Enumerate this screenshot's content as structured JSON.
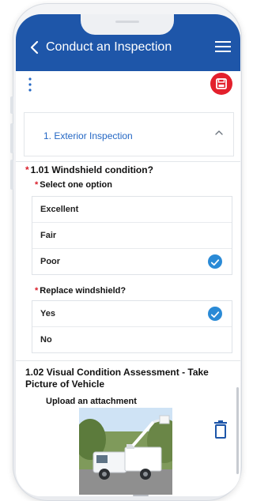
{
  "header": {
    "title": "Conduct an Inspection",
    "back_icon": "chevron-left-icon",
    "menu_icon": "hamburger-menu-icon"
  },
  "toolbar": {
    "more_icon": "kebab-icon",
    "save_icon": "save-icon"
  },
  "section": {
    "title": "1. Exterior Inspection",
    "icon": "chevron-up-icon"
  },
  "questions": [
    {
      "number_label": "1.01 Windshield condition?",
      "sub_label": "Select one option",
      "options": [
        {
          "label": "Excellent",
          "selected": false
        },
        {
          "label": "Fair",
          "selected": false
        },
        {
          "label": "Poor",
          "selected": true
        }
      ]
    },
    {
      "sub_label": "Replace windshield?",
      "options": [
        {
          "label": "Yes",
          "selected": true
        },
        {
          "label": "No",
          "selected": false
        }
      ]
    },
    {
      "number_label": "1.02 Visual Condition Assessment - Take Picture of Vehicle",
      "sub_label": "Upload an attachment",
      "delete_icon": "trash-icon"
    }
  ],
  "colors": {
    "header_bg": "#1e56a9",
    "accent": "#2a8ad6",
    "required": "#d91e2a",
    "save_button": "#e3202c"
  }
}
